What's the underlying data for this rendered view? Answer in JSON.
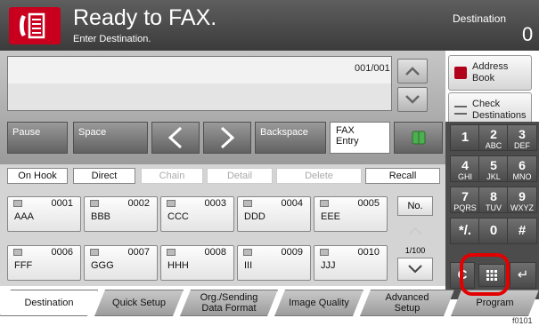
{
  "header": {
    "title": "Ready to FAX.",
    "subtitle": "Enter Destination.",
    "destination_label": "Destination",
    "destination_count": "0"
  },
  "destination_field": {
    "value": "",
    "page_count": "001/001"
  },
  "side_buttons": {
    "address_book": "Address Book",
    "check_destinations": "Check Destinations"
  },
  "edit_bar": {
    "pause": "Pause",
    "space": "Space",
    "backspace": "Backspace",
    "fax_entry_line1": "FAX",
    "fax_entry_line2": "Entry"
  },
  "keypad": [
    {
      "num": "1",
      "letters": ""
    },
    {
      "num": "2",
      "letters": "ABC"
    },
    {
      "num": "3",
      "letters": "DEF"
    },
    {
      "num": "4",
      "letters": "GHI"
    },
    {
      "num": "5",
      "letters": "JKL"
    },
    {
      "num": "6",
      "letters": "MNO"
    },
    {
      "num": "7",
      "letters": "PQRS"
    },
    {
      "num": "8",
      "letters": "TUV"
    },
    {
      "num": "9",
      "letters": "WXYZ"
    },
    {
      "num": "*/.",
      "letters": ""
    },
    {
      "num": "0",
      "letters": ""
    },
    {
      "num": "#",
      "letters": ""
    }
  ],
  "list_toolbar": {
    "on_hook": "On Hook",
    "direct": "Direct",
    "chain": "Chain",
    "detail": "Detail",
    "delete": "Delete",
    "recall": "Recall"
  },
  "destinations": [
    {
      "num": "0001",
      "name": "AAA"
    },
    {
      "num": "0002",
      "name": "BBB"
    },
    {
      "num": "0003",
      "name": "CCC"
    },
    {
      "num": "0004",
      "name": "DDD"
    },
    {
      "num": "0005",
      "name": "EEE"
    },
    {
      "num": "0006",
      "name": "FFF"
    },
    {
      "num": "0007",
      "name": "GGG"
    },
    {
      "num": "0008",
      "name": "HHH"
    },
    {
      "num": "0009",
      "name": "III"
    },
    {
      "num": "0010",
      "name": "JJJ"
    }
  ],
  "list_nav": {
    "no_button": "No.",
    "page": "1/100"
  },
  "bottom_tabs": {
    "destination": "Destination",
    "quick_setup": "Quick Setup",
    "org_sending_line1": "Org./Sending",
    "org_sending_line2": "Data Format",
    "image_quality": "Image Quality",
    "advanced_line1": "Advanced",
    "advanced_line2": "Setup",
    "program": "Program"
  },
  "figure_code": "f0101",
  "icons": {
    "fax": "fax-icon",
    "address_book": "address-book-icon",
    "check": "check-list-icon",
    "book": "book-icon",
    "clear": "clear-icon",
    "enter": "enter-icon"
  },
  "colors": {
    "accent": "#c8001e",
    "highlight": "#e20000"
  }
}
